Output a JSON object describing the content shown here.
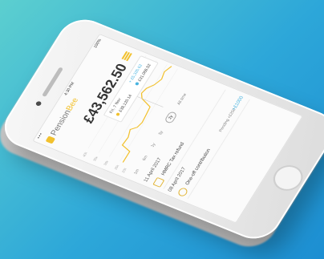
{
  "app": {
    "logo_a": "Pension",
    "logo_b": "Bee",
    "status_time": "4:30 PM",
    "battery": "100%",
    "signal": "•••"
  },
  "balance": "£43,562.50",
  "tooltip": {
    "date": "Fri, 7 Nov",
    "value1": "£38,120.14",
    "change": "+ £5,326.62",
    "value2": "£31,068.52"
  },
  "chart_labels": [
    "40k",
    "35k",
    "30k",
    "25k",
    "20k"
  ],
  "ranges": [
    {
      "label": "1m"
    },
    {
      "label": "6m"
    },
    {
      "label": "1y"
    },
    {
      "label": "5y"
    },
    {
      "label": "2y"
    },
    {
      "label": "All time"
    }
  ],
  "transactions": [
    {
      "date": "11 April 2017",
      "label": "HMRC Tax refund",
      "status": "",
      "amount": ""
    },
    {
      "date": "08 April 2017",
      "label": "One-off contribution",
      "status": "Pending  +£250",
      "amount": "+£1000"
    }
  ],
  "colors": {
    "brand": "#f2c12e",
    "accent": "#48b4e0",
    "background_start": "#5ccfcf",
    "background_end": "#1c8ed2"
  }
}
